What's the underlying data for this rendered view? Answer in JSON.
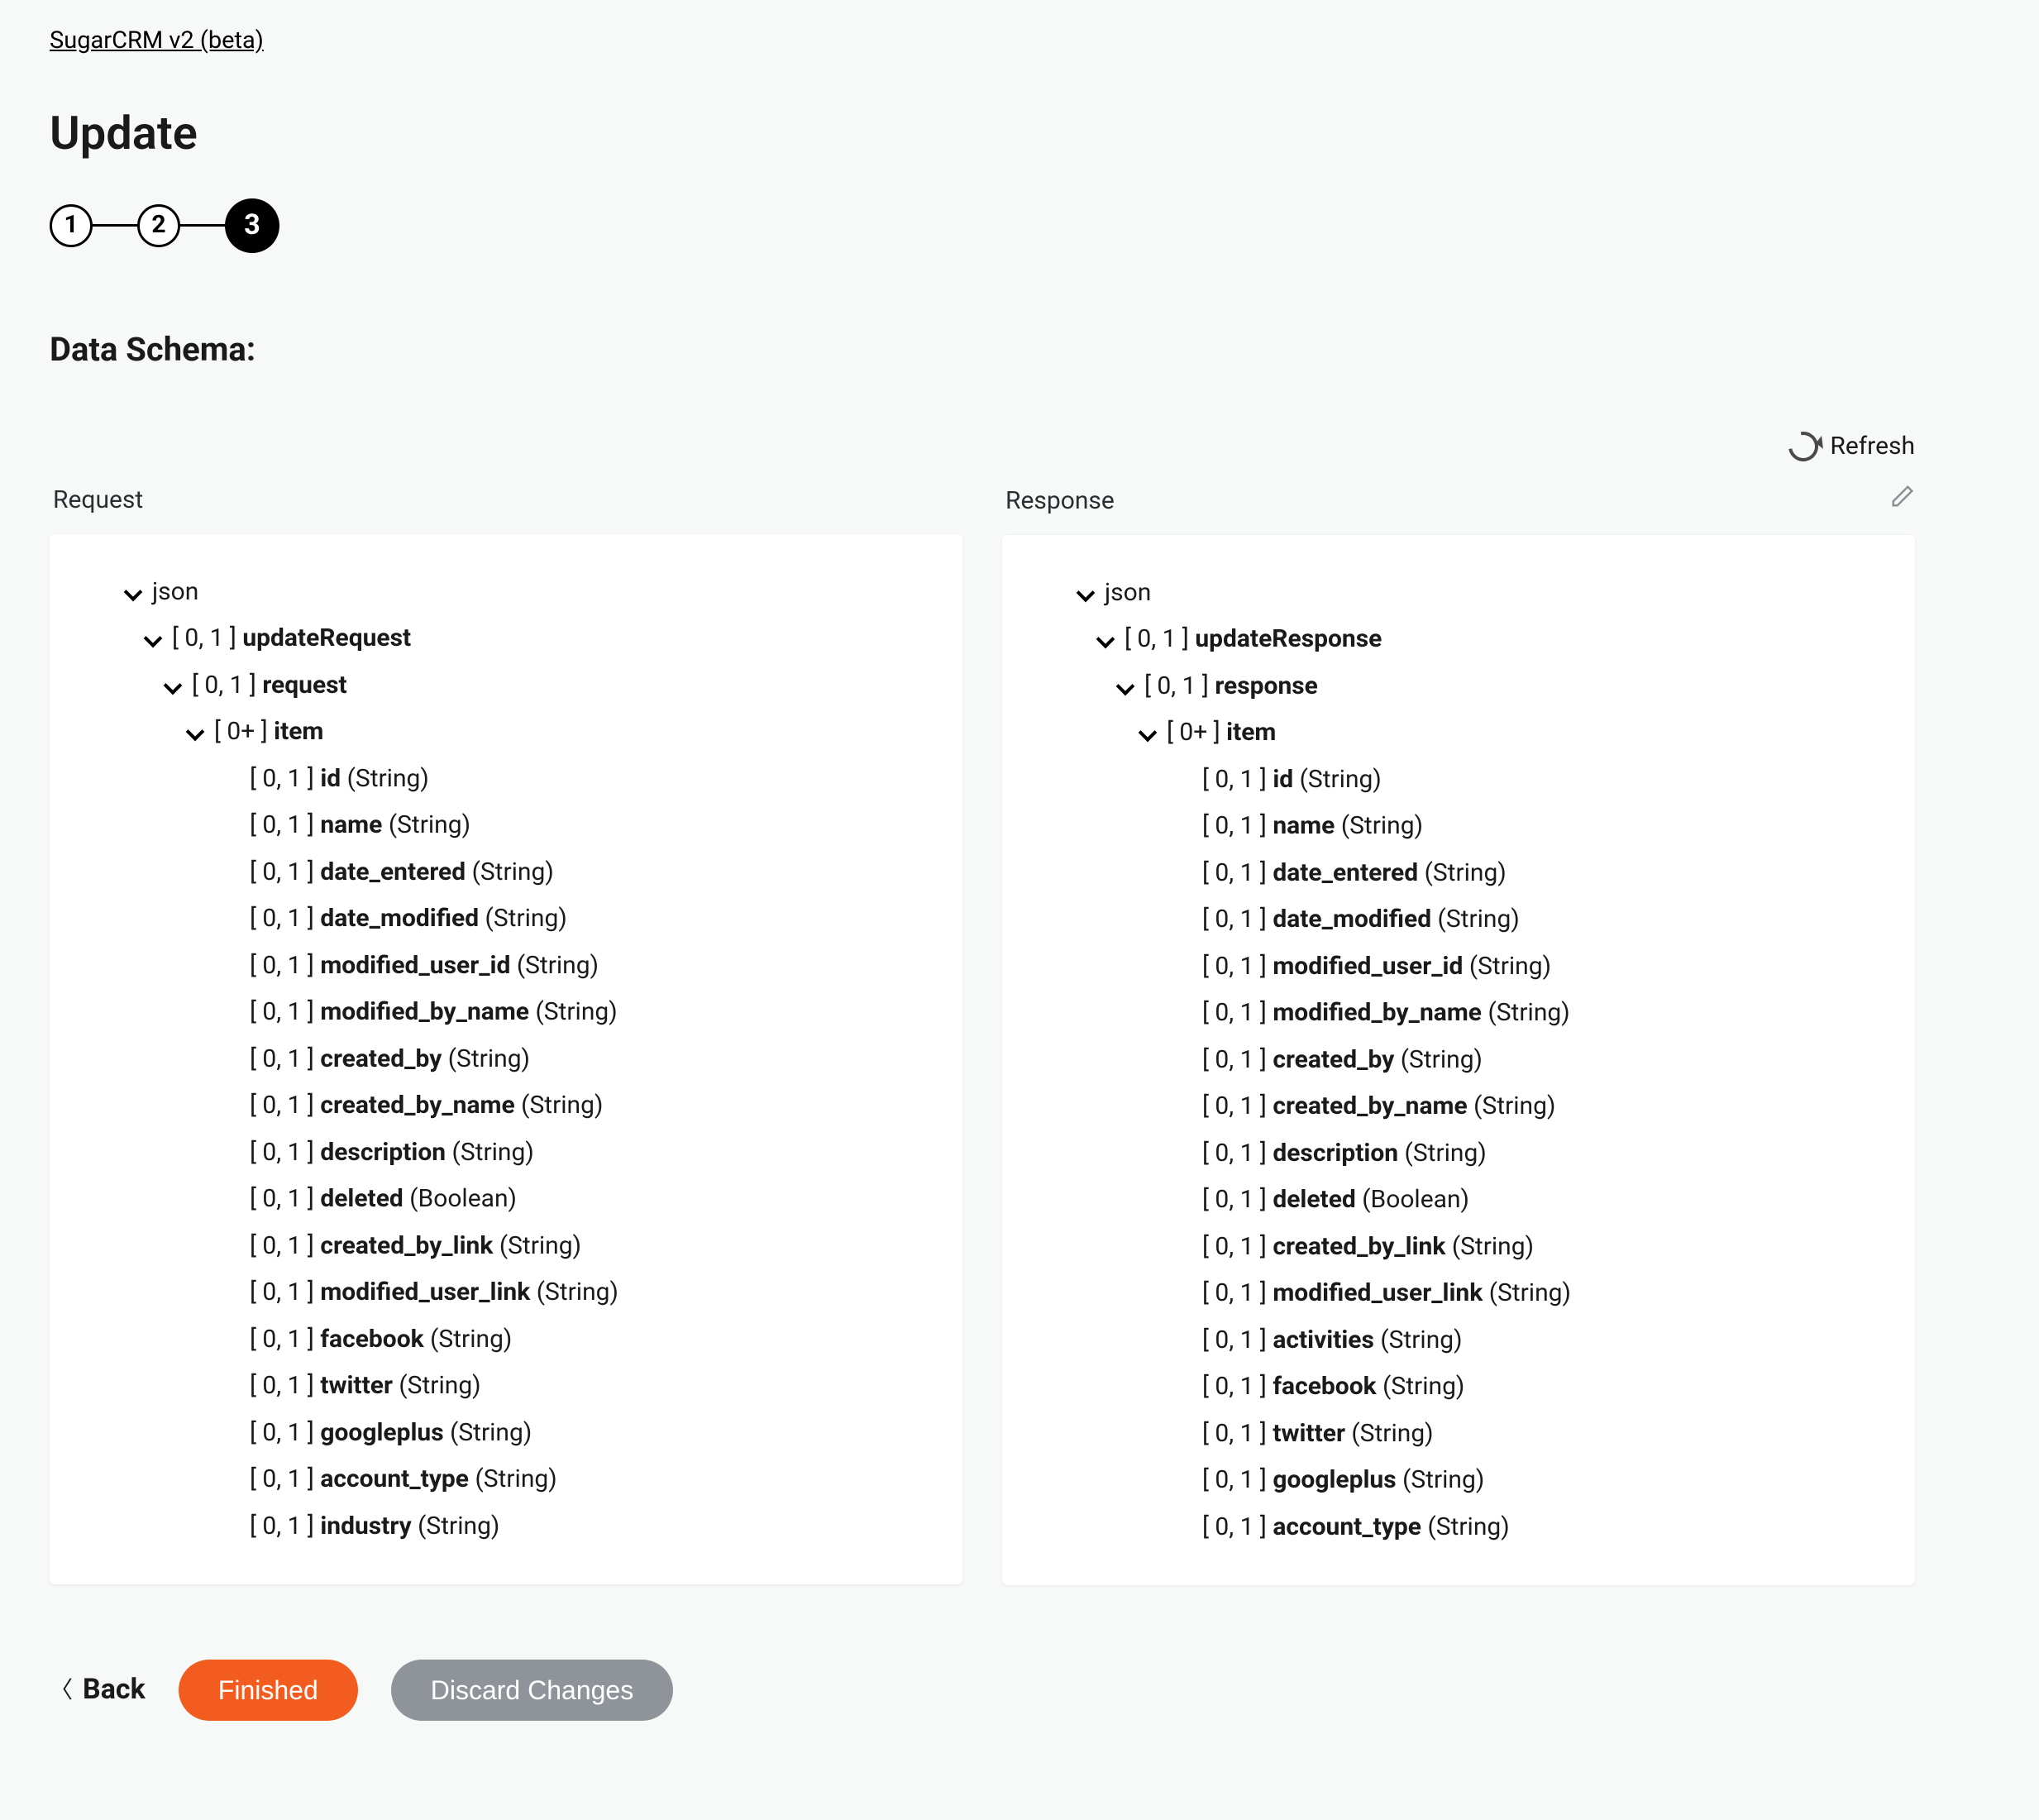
{
  "breadcrumb": "SugarCRM v2 (beta)",
  "title": "Update",
  "steps": [
    "1",
    "2",
    "3"
  ],
  "active_step_index": 2,
  "section_title": "Data Schema:",
  "refresh_label": "Refresh",
  "columns": {
    "request": {
      "header": "Request",
      "root": "json",
      "envelope": {
        "card": "[ 0, 1 ]",
        "name": "updateRequest"
      },
      "inner": {
        "card": "[ 0, 1 ]",
        "name": "request"
      },
      "item": {
        "card": "[ 0+ ]",
        "name": "item"
      },
      "fields": [
        {
          "card": "[ 0, 1 ]",
          "name": "id",
          "type": "(String)"
        },
        {
          "card": "[ 0, 1 ]",
          "name": "name",
          "type": "(String)"
        },
        {
          "card": "[ 0, 1 ]",
          "name": "date_entered",
          "type": "(String)"
        },
        {
          "card": "[ 0, 1 ]",
          "name": "date_modified",
          "type": "(String)"
        },
        {
          "card": "[ 0, 1 ]",
          "name": "modified_user_id",
          "type": "(String)"
        },
        {
          "card": "[ 0, 1 ]",
          "name": "modified_by_name",
          "type": "(String)"
        },
        {
          "card": "[ 0, 1 ]",
          "name": "created_by",
          "type": "(String)"
        },
        {
          "card": "[ 0, 1 ]",
          "name": "created_by_name",
          "type": "(String)"
        },
        {
          "card": "[ 0, 1 ]",
          "name": "description",
          "type": "(String)"
        },
        {
          "card": "[ 0, 1 ]",
          "name": "deleted",
          "type": "(Boolean)"
        },
        {
          "card": "[ 0, 1 ]",
          "name": "created_by_link",
          "type": "(String)"
        },
        {
          "card": "[ 0, 1 ]",
          "name": "modified_user_link",
          "type": "(String)"
        },
        {
          "card": "[ 0, 1 ]",
          "name": "facebook",
          "type": "(String)"
        },
        {
          "card": "[ 0, 1 ]",
          "name": "twitter",
          "type": "(String)"
        },
        {
          "card": "[ 0, 1 ]",
          "name": "googleplus",
          "type": "(String)"
        },
        {
          "card": "[ 0, 1 ]",
          "name": "account_type",
          "type": "(String)"
        },
        {
          "card": "[ 0, 1 ]",
          "name": "industry",
          "type": "(String)"
        }
      ]
    },
    "response": {
      "header": "Response",
      "root": "json",
      "envelope": {
        "card": "[ 0, 1 ]",
        "name": "updateResponse"
      },
      "inner": {
        "card": "[ 0, 1 ]",
        "name": "response"
      },
      "item": {
        "card": "[ 0+ ]",
        "name": "item"
      },
      "fields": [
        {
          "card": "[ 0, 1 ]",
          "name": "id",
          "type": "(String)"
        },
        {
          "card": "[ 0, 1 ]",
          "name": "name",
          "type": "(String)"
        },
        {
          "card": "[ 0, 1 ]",
          "name": "date_entered",
          "type": "(String)"
        },
        {
          "card": "[ 0, 1 ]",
          "name": "date_modified",
          "type": "(String)"
        },
        {
          "card": "[ 0, 1 ]",
          "name": "modified_user_id",
          "type": "(String)"
        },
        {
          "card": "[ 0, 1 ]",
          "name": "modified_by_name",
          "type": "(String)"
        },
        {
          "card": "[ 0, 1 ]",
          "name": "created_by",
          "type": "(String)"
        },
        {
          "card": "[ 0, 1 ]",
          "name": "created_by_name",
          "type": "(String)"
        },
        {
          "card": "[ 0, 1 ]",
          "name": "description",
          "type": "(String)"
        },
        {
          "card": "[ 0, 1 ]",
          "name": "deleted",
          "type": "(Boolean)"
        },
        {
          "card": "[ 0, 1 ]",
          "name": "created_by_link",
          "type": "(String)"
        },
        {
          "card": "[ 0, 1 ]",
          "name": "modified_user_link",
          "type": "(String)"
        },
        {
          "card": "[ 0, 1 ]",
          "name": "activities",
          "type": "(String)"
        },
        {
          "card": "[ 0, 1 ]",
          "name": "facebook",
          "type": "(String)"
        },
        {
          "card": "[ 0, 1 ]",
          "name": "twitter",
          "type": "(String)"
        },
        {
          "card": "[ 0, 1 ]",
          "name": "googleplus",
          "type": "(String)"
        },
        {
          "card": "[ 0, 1 ]",
          "name": "account_type",
          "type": "(String)"
        }
      ]
    }
  },
  "footer": {
    "back": "Back",
    "finished": "Finished",
    "discard": "Discard Changes"
  }
}
